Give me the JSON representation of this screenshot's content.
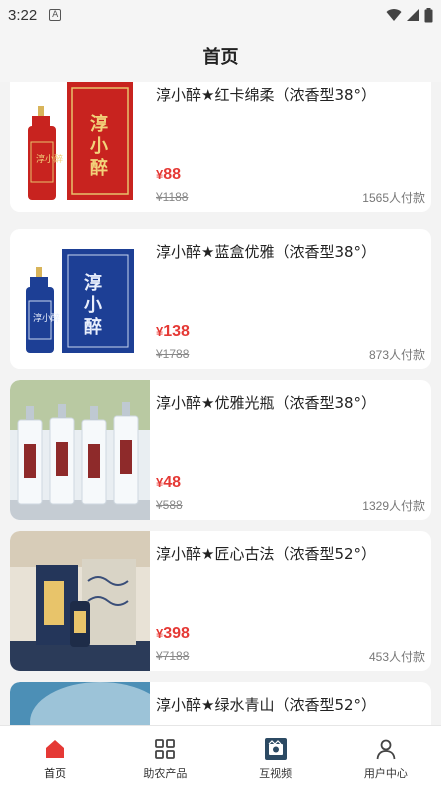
{
  "status": {
    "time": "3:22",
    "badge": "A"
  },
  "header": {
    "title": "首页"
  },
  "products": [
    {
      "name": "淳小醉★红卡绵柔（浓香型38°）",
      "price": "88",
      "original_price": "¥1188",
      "sold": "1565人付款",
      "currency": "¥",
      "thumb_color": "#c8231f",
      "thumb_label": "淳小醉"
    },
    {
      "name": "淳小醉★蓝盒优雅（浓香型38°）",
      "price": "138",
      "original_price": "¥1788",
      "sold": "873人付款",
      "currency": "¥",
      "thumb_color": "#1d3f95",
      "thumb_label": "淳小醉"
    },
    {
      "name": "淳小醉★优雅光瓶（浓香型38°）",
      "price": "48",
      "original_price": "¥588",
      "sold": "1329人付款",
      "currency": "¥",
      "thumb_color": "#e9eef2",
      "thumb_label": "淳小醉"
    },
    {
      "name": "淳小醉★匠心古法（浓香型52°）",
      "price": "398",
      "original_price": "¥7188",
      "sold": "453人付款",
      "currency": "¥",
      "thumb_color": "#2a3e63",
      "thumb_label": "淳小醉"
    },
    {
      "name": "淳小醉★绿水青山（浓香型52°）",
      "price": "",
      "original_price": "",
      "sold": "",
      "currency": "",
      "thumb_color": "#4c8fb6",
      "thumb_label": ""
    }
  ],
  "tabs": [
    {
      "label": "首页",
      "icon": "home-icon",
      "active": true
    },
    {
      "label": "助农产品",
      "icon": "grid-icon",
      "active": false
    },
    {
      "label": "互视频",
      "icon": "video-icon",
      "active": false
    },
    {
      "label": "用户中心",
      "icon": "user-icon",
      "active": false
    }
  ],
  "colors": {
    "accent": "#e53935",
    "background": "#f3f3f3"
  }
}
